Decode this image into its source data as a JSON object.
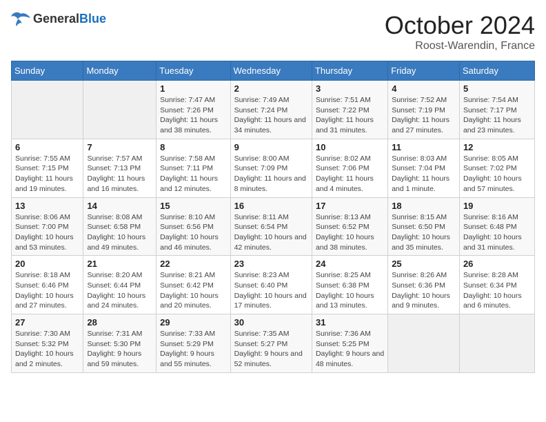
{
  "header": {
    "logo_general": "General",
    "logo_blue": "Blue",
    "month": "October 2024",
    "location": "Roost-Warendin, France"
  },
  "weekdays": [
    "Sunday",
    "Monday",
    "Tuesday",
    "Wednesday",
    "Thursday",
    "Friday",
    "Saturday"
  ],
  "weeks": [
    [
      {
        "day": "",
        "info": ""
      },
      {
        "day": "",
        "info": ""
      },
      {
        "day": "1",
        "info": "Sunrise: 7:47 AM\nSunset: 7:26 PM\nDaylight: 11 hours and 38 minutes."
      },
      {
        "day": "2",
        "info": "Sunrise: 7:49 AM\nSunset: 7:24 PM\nDaylight: 11 hours and 34 minutes."
      },
      {
        "day": "3",
        "info": "Sunrise: 7:51 AM\nSunset: 7:22 PM\nDaylight: 11 hours and 31 minutes."
      },
      {
        "day": "4",
        "info": "Sunrise: 7:52 AM\nSunset: 7:19 PM\nDaylight: 11 hours and 27 minutes."
      },
      {
        "day": "5",
        "info": "Sunrise: 7:54 AM\nSunset: 7:17 PM\nDaylight: 11 hours and 23 minutes."
      }
    ],
    [
      {
        "day": "6",
        "info": "Sunrise: 7:55 AM\nSunset: 7:15 PM\nDaylight: 11 hours and 19 minutes."
      },
      {
        "day": "7",
        "info": "Sunrise: 7:57 AM\nSunset: 7:13 PM\nDaylight: 11 hours and 16 minutes."
      },
      {
        "day": "8",
        "info": "Sunrise: 7:58 AM\nSunset: 7:11 PM\nDaylight: 11 hours and 12 minutes."
      },
      {
        "day": "9",
        "info": "Sunrise: 8:00 AM\nSunset: 7:09 PM\nDaylight: 11 hours and 8 minutes."
      },
      {
        "day": "10",
        "info": "Sunrise: 8:02 AM\nSunset: 7:06 PM\nDaylight: 11 hours and 4 minutes."
      },
      {
        "day": "11",
        "info": "Sunrise: 8:03 AM\nSunset: 7:04 PM\nDaylight: 11 hours and 1 minute."
      },
      {
        "day": "12",
        "info": "Sunrise: 8:05 AM\nSunset: 7:02 PM\nDaylight: 10 hours and 57 minutes."
      }
    ],
    [
      {
        "day": "13",
        "info": "Sunrise: 8:06 AM\nSunset: 7:00 PM\nDaylight: 10 hours and 53 minutes."
      },
      {
        "day": "14",
        "info": "Sunrise: 8:08 AM\nSunset: 6:58 PM\nDaylight: 10 hours and 49 minutes."
      },
      {
        "day": "15",
        "info": "Sunrise: 8:10 AM\nSunset: 6:56 PM\nDaylight: 10 hours and 46 minutes."
      },
      {
        "day": "16",
        "info": "Sunrise: 8:11 AM\nSunset: 6:54 PM\nDaylight: 10 hours and 42 minutes."
      },
      {
        "day": "17",
        "info": "Sunrise: 8:13 AM\nSunset: 6:52 PM\nDaylight: 10 hours and 38 minutes."
      },
      {
        "day": "18",
        "info": "Sunrise: 8:15 AM\nSunset: 6:50 PM\nDaylight: 10 hours and 35 minutes."
      },
      {
        "day": "19",
        "info": "Sunrise: 8:16 AM\nSunset: 6:48 PM\nDaylight: 10 hours and 31 minutes."
      }
    ],
    [
      {
        "day": "20",
        "info": "Sunrise: 8:18 AM\nSunset: 6:46 PM\nDaylight: 10 hours and 27 minutes."
      },
      {
        "day": "21",
        "info": "Sunrise: 8:20 AM\nSunset: 6:44 PM\nDaylight: 10 hours and 24 minutes."
      },
      {
        "day": "22",
        "info": "Sunrise: 8:21 AM\nSunset: 6:42 PM\nDaylight: 10 hours and 20 minutes."
      },
      {
        "day": "23",
        "info": "Sunrise: 8:23 AM\nSunset: 6:40 PM\nDaylight: 10 hours and 17 minutes."
      },
      {
        "day": "24",
        "info": "Sunrise: 8:25 AM\nSunset: 6:38 PM\nDaylight: 10 hours and 13 minutes."
      },
      {
        "day": "25",
        "info": "Sunrise: 8:26 AM\nSunset: 6:36 PM\nDaylight: 10 hours and 9 minutes."
      },
      {
        "day": "26",
        "info": "Sunrise: 8:28 AM\nSunset: 6:34 PM\nDaylight: 10 hours and 6 minutes."
      }
    ],
    [
      {
        "day": "27",
        "info": "Sunrise: 7:30 AM\nSunset: 5:32 PM\nDaylight: 10 hours and 2 minutes."
      },
      {
        "day": "28",
        "info": "Sunrise: 7:31 AM\nSunset: 5:30 PM\nDaylight: 9 hours and 59 minutes."
      },
      {
        "day": "29",
        "info": "Sunrise: 7:33 AM\nSunset: 5:29 PM\nDaylight: 9 hours and 55 minutes."
      },
      {
        "day": "30",
        "info": "Sunrise: 7:35 AM\nSunset: 5:27 PM\nDaylight: 9 hours and 52 minutes."
      },
      {
        "day": "31",
        "info": "Sunrise: 7:36 AM\nSunset: 5:25 PM\nDaylight: 9 hours and 48 minutes."
      },
      {
        "day": "",
        "info": ""
      },
      {
        "day": "",
        "info": ""
      }
    ]
  ]
}
